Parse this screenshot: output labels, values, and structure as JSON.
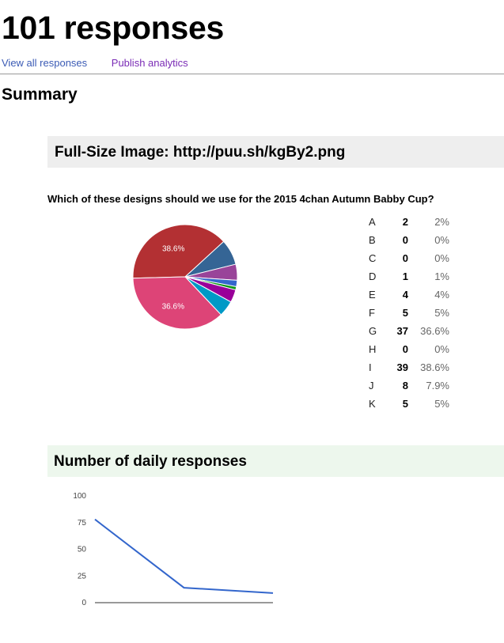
{
  "header": {
    "title": "101 responses",
    "links": {
      "view_all": "View all responses",
      "publish": "Publish analytics"
    },
    "summary": "Summary"
  },
  "section_image": {
    "title": "Full-Size Image: http://puu.sh/kgBy2.png"
  },
  "question": "Which of these designs should we use for the 2015 4chan Autumn Babby Cup?",
  "results": [
    {
      "option": "A",
      "count": "2",
      "percent": "2%"
    },
    {
      "option": "B",
      "count": "0",
      "percent": "0%"
    },
    {
      "option": "C",
      "count": "0",
      "percent": "0%"
    },
    {
      "option": "D",
      "count": "1",
      "percent": "1%"
    },
    {
      "option": "E",
      "count": "4",
      "percent": "4%"
    },
    {
      "option": "F",
      "count": "5",
      "percent": "5%"
    },
    {
      "option": "G",
      "count": "37",
      "percent": "36.6%"
    },
    {
      "option": "H",
      "count": "0",
      "percent": "0%"
    },
    {
      "option": "I",
      "count": "39",
      "percent": "38.6%"
    },
    {
      "option": "J",
      "count": "8",
      "percent": "7.9%"
    },
    {
      "option": "K",
      "count": "5",
      "percent": "5%"
    }
  ],
  "section_daily": {
    "title": "Number of daily responses"
  },
  "chart_data": [
    {
      "type": "pie",
      "title": "Which of these designs should we use for the 2015 4chan Autumn Babby Cup?",
      "slices": [
        {
          "label": "I",
          "value": 39,
          "percent": 38.6,
          "color": "#b33033",
          "data_label": "38.6%"
        },
        {
          "label": "J",
          "value": 8,
          "percent": 7.9,
          "color": "#356595",
          "data_label": ""
        },
        {
          "label": "K",
          "value": 5,
          "percent": 5,
          "color": "#994499",
          "data_label": ""
        },
        {
          "label": "A",
          "value": 2,
          "percent": 2,
          "color": "#3366cc",
          "data_label": ""
        },
        {
          "label": "D",
          "value": 1,
          "percent": 1,
          "color": "#109618",
          "data_label": ""
        },
        {
          "label": "E",
          "value": 4,
          "percent": 4,
          "color": "#990099",
          "data_label": ""
        },
        {
          "label": "F",
          "value": 5,
          "percent": 5,
          "color": "#0099c6",
          "data_label": ""
        },
        {
          "label": "G",
          "value": 37,
          "percent": 36.6,
          "color": "#dd4477",
          "data_label": "36.6%"
        }
      ]
    },
    {
      "type": "line",
      "title": "Number of daily responses",
      "x": [
        1,
        2,
        3
      ],
      "series": [
        {
          "name": "Responses",
          "values": [
            78,
            14,
            9
          ],
          "color": "#3366cc"
        }
      ],
      "ylim": [
        0,
        100
      ],
      "yticks": [
        "0",
        "25",
        "50",
        "75",
        "100"
      ],
      "grid": false,
      "legend": "none"
    }
  ]
}
